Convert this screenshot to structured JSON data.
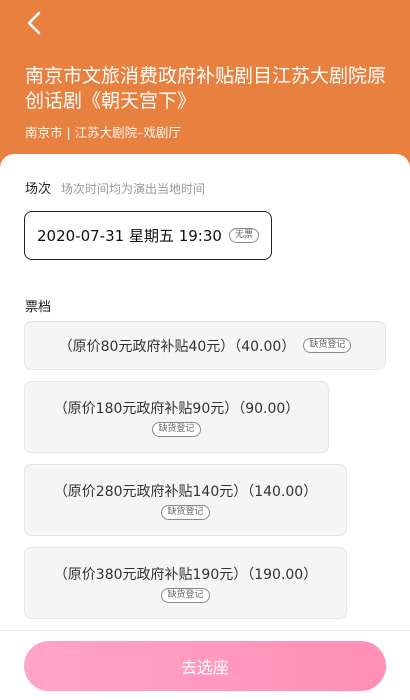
{
  "header": {
    "back_icon": "chevron-left-icon",
    "title": "南京市文旅消费政府补贴剧目江苏大剧院原创话剧《朝天宫下》",
    "venue": "南京市 | 江苏大剧院–戏剧厅"
  },
  "session": {
    "label": "场次",
    "note": "场次时间均为演出当地时间",
    "date": "2020-07-31 星期五 19:30",
    "status": "无票"
  },
  "tickets": {
    "label": "票档",
    "items": [
      {
        "text": "（原价80元政府补贴40元）（40.00）",
        "status": "缺货登记"
      },
      {
        "text": "（原价180元政府补贴90元）（90.00）",
        "status": "缺货登记"
      },
      {
        "text": "（原价280元政府补贴140元）（140.00）",
        "status": "缺货登记"
      },
      {
        "text": "（原价380元政府补贴190元）（190.00）",
        "status": "缺货登记"
      }
    ]
  },
  "footer": {
    "select_label": "去选座"
  },
  "colors": {
    "header_bg": "#e8803f",
    "button_gradient_start": "#ffa5c7",
    "button_gradient_end": "#ff8fb5"
  }
}
